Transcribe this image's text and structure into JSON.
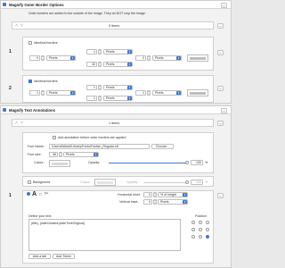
{
  "outer": {
    "title": "Magnify Outer Border Options",
    "note": "Outer borders are added to the outside of the image. They do NOT crop the image.",
    "count": "0 items",
    "row1": {
      "num": "1",
      "checkbox": "Identical borders",
      "top": {
        "value": "1",
        "unit": "Pixels"
      },
      "left": {
        "value": "0",
        "unit": "Pixels"
      },
      "bottom": {
        "value": "40",
        "unit": "Pixels"
      },
      "right": {
        "value": "0",
        "unit": "Pixels"
      }
    },
    "row2": {
      "num": "2",
      "checkbox": "Identical borders",
      "top": {
        "value": "1",
        "unit": "Pixels"
      },
      "left": {
        "value": "1",
        "unit": "Pixels"
      },
      "bottom": {
        "value": "1",
        "unit": "Pixels"
      },
      "right": {
        "value": "1",
        "unit": "Pixels"
      }
    }
  },
  "text": {
    "title": "Magnify Text Annotations",
    "count": "1 items",
    "add_before": "Add annotation before outer borders are applied",
    "font_name_label": "Font Name:",
    "font_path": "/Users/fallard/Library/Fonts/Fanfan_Regular.otf",
    "choose": "Choose...",
    "font_size_label": "Font size:",
    "font_size_value": "36",
    "font_size_unit": "Pixels",
    "colour_label": "Colour:",
    "opacity_label": "Opacity:",
    "opacity_value": "100",
    "percent": "%",
    "background_label": "Background",
    "bg_colour_label": "Colour:",
    "bg_opacity_label": "Opacity:",
    "bg_opacity_value": "100",
    "item_num": "1",
    "h_inset_label": "Horizontal inset:",
    "h_inset_value": "0",
    "h_inset_unit": "% of height",
    "v_inset_label": "Vertical inset:",
    "v_inset_value": "0",
    "v_inset_unit": "Pixels",
    "define_label": "Define your text:",
    "text_value": "{title}, {dateCreated:{dateTimeOriginal}",
    "position_label": "Position",
    "add_tab": "Add a tab",
    "add_token": "Add Token",
    "minus": "−"
  }
}
